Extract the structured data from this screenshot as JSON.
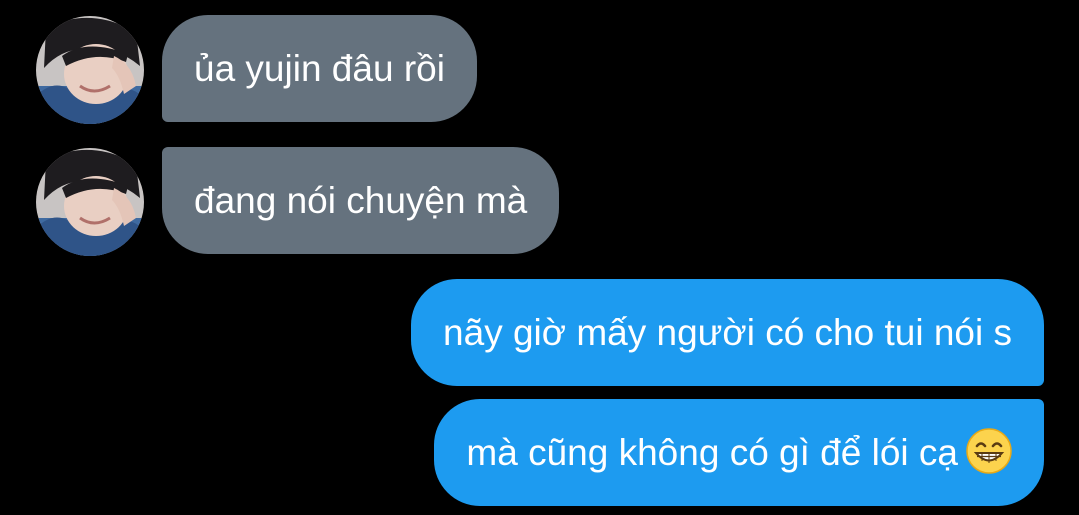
{
  "conversation": {
    "messages": [
      {
        "sender": "other",
        "text": "ủa yujin đâu rồi",
        "avatar": "user-photo"
      },
      {
        "sender": "other",
        "text": "đang nói chuyện mà",
        "avatar": "user-photo"
      },
      {
        "sender": "me",
        "text": "nãy giờ mấy người có cho tui nói s"
      },
      {
        "sender": "me",
        "text": "mà cũng không có gì để lói cạ",
        "emoji": "grinning-face-with-smiling-eyes"
      }
    ]
  },
  "colors": {
    "background": "#000000",
    "received_bubble": "#65727e",
    "sent_bubble": "#1d9bf0",
    "text": "#ffffff"
  }
}
